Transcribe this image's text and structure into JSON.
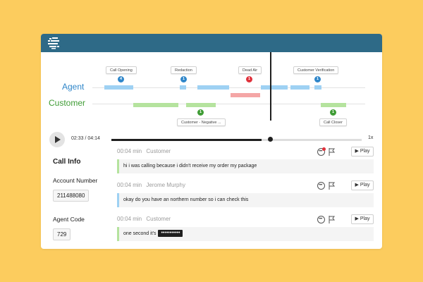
{
  "timeline": {
    "agent_label": "Agent",
    "customer_label": "Customer",
    "tags_top": [
      {
        "label": "Call Opening",
        "badge": "4",
        "color": "blue"
      },
      {
        "label": "Redaction",
        "badge": "1",
        "color": "blue"
      },
      {
        "label": "Dead Air",
        "badge": "1",
        "color": "red"
      },
      {
        "label": "Customer Verification",
        "badge": "1",
        "color": "blue"
      }
    ],
    "tags_bottom": [
      {
        "label": "Customer - Negative ...",
        "badge": "1",
        "color": "green"
      },
      {
        "label": "Call Closer",
        "badge": "1",
        "color": "green"
      }
    ]
  },
  "player": {
    "time": "02:33 / 04:14",
    "progress": 0.6,
    "speed": "1x"
  },
  "call_info": {
    "title": "Call Info",
    "fields": [
      {
        "label": "Account Number",
        "value": "211488080"
      },
      {
        "label": "Agent Code",
        "value": "729"
      }
    ]
  },
  "transcript": [
    {
      "duration": "00:04 min",
      "speaker": "Customer",
      "text": "hi i was calling because i didn't receive my order my package",
      "redacted": "",
      "role": "customer",
      "comment_notification": true
    },
    {
      "duration": "00:04 min",
      "speaker": "Jerome Murphy",
      "text": "okay do you have an northern number so i can check this",
      "redacted": "",
      "role": "agent",
      "comment_notification": false
    },
    {
      "duration": "00:04 min",
      "speaker": "Customer",
      "text": "one second it's",
      "redacted": "•••••••••••",
      "role": "customer",
      "comment_notification": false
    }
  ],
  "labels": {
    "play": "Play"
  },
  "colors": {
    "background": "#fccc5e",
    "titlebar": "#2e6a87",
    "agent": "#2f86c9",
    "customer": "#3f9c35",
    "dead_air": "#e0313b"
  }
}
